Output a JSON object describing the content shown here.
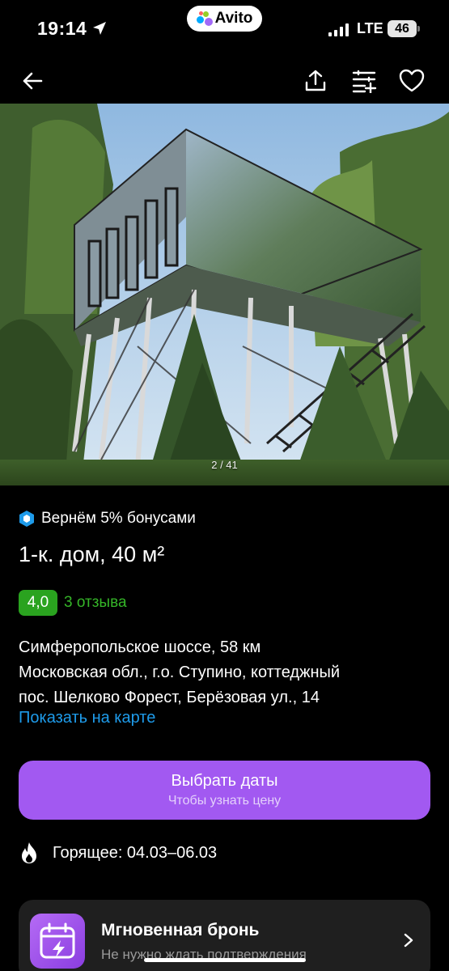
{
  "status_bar": {
    "time": "19:14",
    "brand": "Avito",
    "network": "LTE",
    "battery": "46"
  },
  "nav": {
    "icons": [
      "back-arrow-icon",
      "share-icon",
      "compare-icon",
      "heart-icon"
    ]
  },
  "photo": {
    "counter": "2 / 41"
  },
  "listing": {
    "bonus_text": "Вернём 5% бонусами",
    "title": "1-к. дом, 40 м²",
    "rating": "4,0",
    "reviews": "3 отзыва",
    "address_line1": "Симферопольское шоссе, 58 км",
    "address_line2": "Московская обл., г.о. Ступино, коттеджный",
    "address_line3": "пос. Шелково Форест, Берёзовая ул., 14",
    "map_link": "Показать на карте"
  },
  "cta": {
    "title": "Выбрать даты",
    "subtitle": "Чтобы узнать цену"
  },
  "hot_deal": {
    "text": "Горящее: 04.03–06.03"
  },
  "instant_booking": {
    "title": "Мгновенная бронь",
    "subtitle": "Не нужно ждать подтверждения"
  },
  "colors": {
    "accent_purple": "#a259f1",
    "rating_green": "#2aa31f",
    "link_blue": "#1e9bea",
    "bonus_blue": "#1e9bea"
  }
}
